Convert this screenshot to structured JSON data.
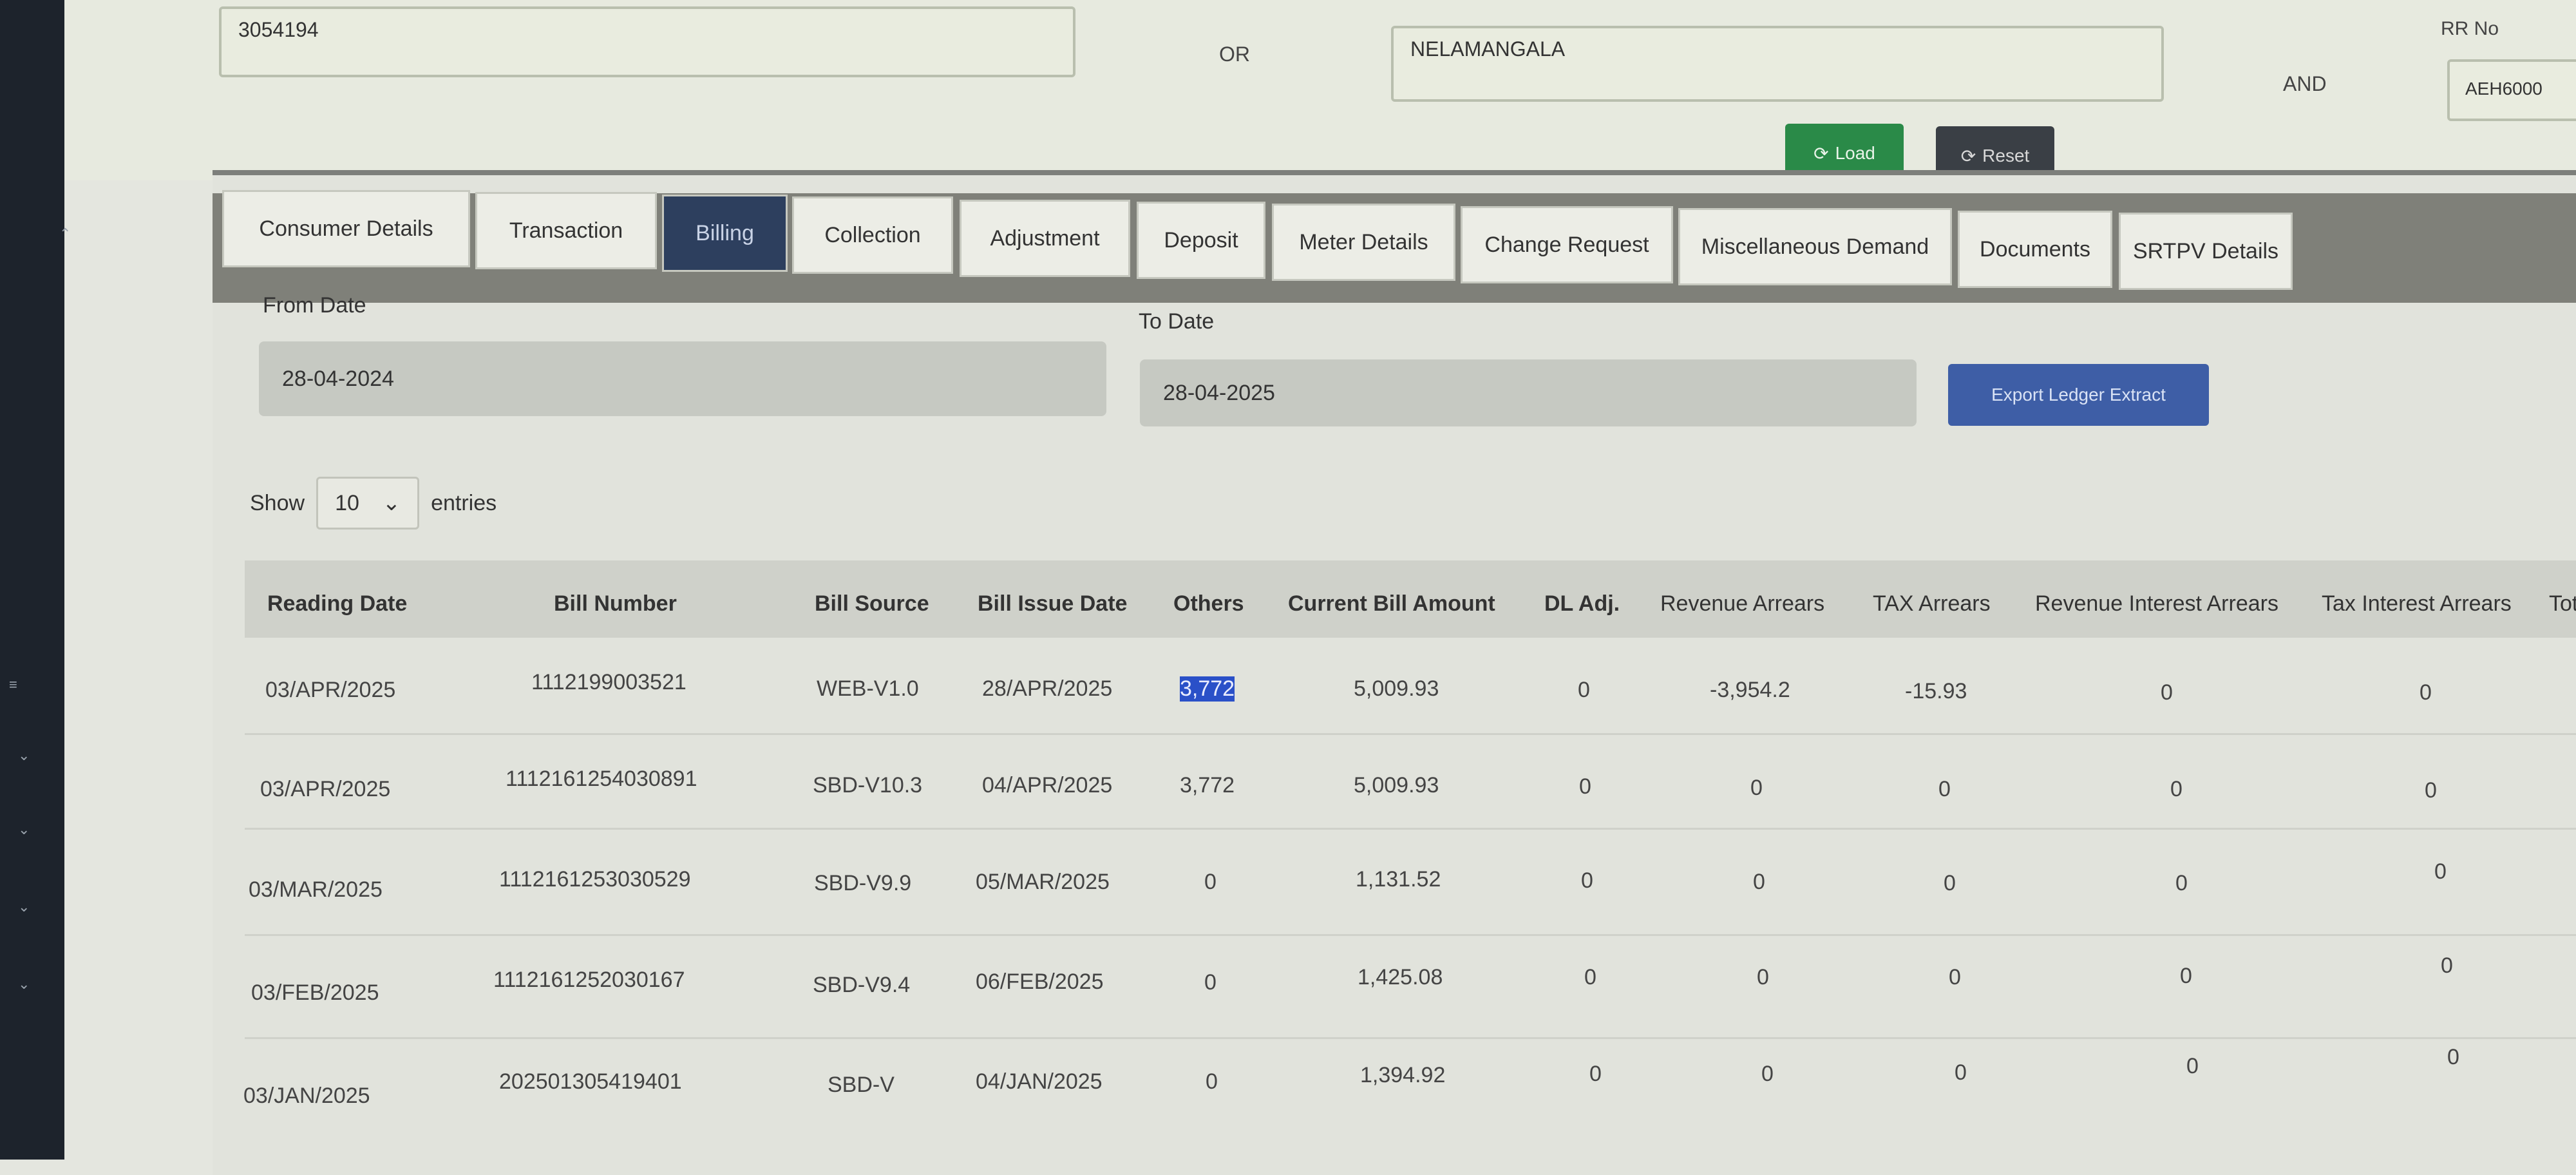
{
  "top": {
    "consumer_value": "3054194",
    "or_label": "OR",
    "accounting_unit_value": "NELAMANGALA",
    "and_label": "AND",
    "rr_label": "RR No",
    "rr_value": "AEH6000",
    "load_label": "Load",
    "reset_label": "Reset"
  },
  "tabs": [
    {
      "label": "Consumer Details"
    },
    {
      "label": "Transaction"
    },
    {
      "label": "Billing"
    },
    {
      "label": "Collection"
    },
    {
      "label": "Adjustment"
    },
    {
      "label": "Deposit"
    },
    {
      "label": "Meter Details"
    },
    {
      "label": "Change Request"
    },
    {
      "label": "Miscellaneous Demand"
    },
    {
      "label": "Documents"
    },
    {
      "label": "SRTPV Details"
    }
  ],
  "filters": {
    "from_label": "From Date",
    "from_value": "28-04-2024",
    "to_label": "To Date",
    "to_value": "28-04-2025",
    "export_label": "Export Ledger Extract"
  },
  "show": {
    "prefix": "Show",
    "value": "10",
    "suffix": "entries"
  },
  "table": {
    "headers": [
      "Reading Date",
      "Bill Number",
      "Bill Source",
      "Bill Issue Date",
      "Others",
      "Current Bill Amount",
      "DL Adj.",
      "Revenue Arrears",
      "TAX Arrears",
      "Revenue Interest Arrears",
      "Tax Interest Arrears",
      "Tot"
    ],
    "rows": [
      [
        "03/APR/2025",
        "1112199003521",
        "WEB-V1.0",
        "28/APR/2025",
        "3,772",
        "5,009.93",
        "0",
        "-3,954.2",
        "-15.93",
        "0",
        "0"
      ],
      [
        "03/APR/2025",
        "1112161254030891",
        "SBD-V10.3",
        "04/APR/2025",
        "3,772",
        "5,009.93",
        "0",
        "0",
        "0",
        "0",
        "0"
      ],
      [
        "03/MAR/2025",
        "1112161253030529",
        "SBD-V9.9",
        "05/MAR/2025",
        "0",
        "1,131.52",
        "0",
        "0",
        "0",
        "0",
        "0"
      ],
      [
        "03/FEB/2025",
        "1112161252030167",
        "SBD-V9.4",
        "06/FEB/2025",
        "0",
        "1,425.08",
        "0",
        "0",
        "0",
        "0",
        "0"
      ],
      [
        "03/JAN/2025",
        "202501305419401",
        "SBD-V",
        "04/JAN/2025",
        "0",
        "1,394.92",
        "0",
        "0",
        "0",
        "0",
        "0"
      ]
    ]
  }
}
